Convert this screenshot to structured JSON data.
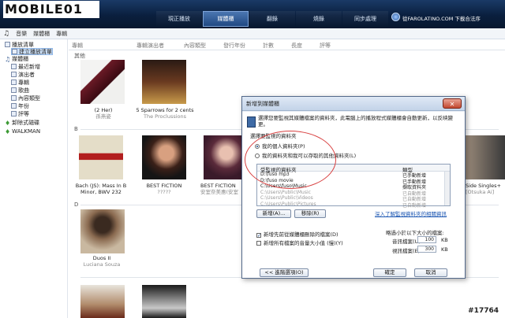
{
  "brand": {
    "logo_text": "MOBILE01"
  },
  "topnav": {
    "tabs": [
      "現正播放",
      "媒體櫃",
      "翻錄",
      "燒錄",
      "同步處理"
    ],
    "active_index": 1,
    "right_text": "從FAROLATINO.COM 下載合法序"
  },
  "address": {
    "crumbs": [
      "音樂",
      "媒體櫃",
      "專輯"
    ]
  },
  "sidebar": {
    "items": [
      {
        "label": "播放清單",
        "icon": "playlist-icon"
      },
      {
        "label": "建立播放清單",
        "icon": "playlist-add-icon"
      },
      {
        "label": "媒體櫃",
        "icon": "music-note-icon"
      },
      {
        "label": "最近新增",
        "icon": "clock-icon"
      },
      {
        "label": "演出者",
        "icon": "artist-icon"
      },
      {
        "label": "專輯",
        "icon": "album-icon"
      },
      {
        "label": "歌曲",
        "icon": "song-icon"
      },
      {
        "label": "內容類型",
        "icon": "genre-icon"
      },
      {
        "label": "年份",
        "icon": "calendar-icon"
      },
      {
        "label": "評等",
        "icon": "star-icon"
      },
      {
        "label": "卸除式磁碟",
        "icon": "drive-icon"
      },
      {
        "label": "WALKMAN",
        "icon": "walkman-icon"
      }
    ]
  },
  "columns": [
    "專輯",
    "專輯演出者",
    "內容類型",
    "發行年份",
    "計數",
    "長度",
    "評等"
  ],
  "groups": [
    {
      "label": "其他"
    },
    {
      "label": "B"
    },
    {
      "label": "D"
    },
    {
      "label": ""
    }
  ],
  "albums": [
    {
      "title": "(2 Her)",
      "artist": "孫燕姿",
      "colors": [
        "#f1f1f0",
        "#5b1220"
      ]
    },
    {
      "title": "5 Sparrows for 2 cents",
      "artist": "The Proclussions",
      "colors": [
        "#2a1a14",
        "#c89a4a"
      ]
    },
    {
      "title": "Bach (JS): Mass In B Minor, BWV 232",
      "artist": "",
      "colors": [
        "#e4ddc8",
        "#b21e1e"
      ]
    },
    {
      "title": "BEST FICTION",
      "artist": "?????",
      "colors": [
        "#151515",
        "#d8a080"
      ]
    },
    {
      "title": "BEST FICTION",
      "artist": "安室奈美惠(安室",
      "colors": [
        "#3a1a2a",
        "#e8c0b0"
      ]
    },
    {
      "title": "Side Singles+",
      "artist": "[Otsuka Ai]",
      "colors": [
        "#3a3a3a",
        "#9a8a7a"
      ]
    },
    {
      "title": "Duos II",
      "artist": "Luciana Souza",
      "colors": [
        "#c9b8a0",
        "#3a2a20"
      ]
    },
    {
      "title": "",
      "artist": "",
      "colors": [
        "#e8e4dc",
        "#6a2a1a"
      ]
    },
    {
      "title": "",
      "artist": "",
      "colors": [
        "#1a1a1a",
        "#c8c8c8"
      ]
    }
  ],
  "dialog": {
    "title": "新增到媒體櫃",
    "close": "✕",
    "description": "選擇您要監視其媒體檔案的資料夾，此電腦上的播放程式媒體櫃會自動更新，以反映變更。",
    "section_title": "選擇要監視的資料夾",
    "radio_options": [
      {
        "label": "我的個人資料夾(P)",
        "selected": true
      },
      {
        "label": "我的資料夾和我可以存取的其他資料夾(L)",
        "selected": false
      }
    ],
    "list": {
      "headers": [
        "受監視的資料夾",
        "類型"
      ],
      "rows": [
        {
          "folder": "D:\\fuso mp3",
          "type": "已手動新增",
          "dim": false
        },
        {
          "folder": "D:\\fuso movie",
          "type": "已手動新增",
          "dim": false
        },
        {
          "folder": "C:\\Users\\fuso\\Music",
          "type": "擷取資料夾",
          "dim": false
        },
        {
          "folder": "C:\\Users\\Public\\Music",
          "type": "已自動新增",
          "dim": true
        },
        {
          "folder": "C:\\Users\\Public\\Videos",
          "type": "已自動新增",
          "dim": true
        },
        {
          "folder": "C:\\Users\\Public\\Pictures",
          "type": "已自動新增",
          "dim": true
        }
      ]
    },
    "buttons": {
      "add": "新增(A)...",
      "remove": "移除(R)",
      "advanced": "<< 進階選項(O)",
      "ok": "確定",
      "cancel": "取消"
    },
    "link": "深入了解監視資料夾的相關資訊",
    "checkboxes": [
      {
        "label": "新增先前從媒體櫃刪除的檔案(D)",
        "checked": true
      },
      {
        "label": "新增所有檔案的音量大小值 (慢)(Y)",
        "checked": false
      }
    ],
    "skip": {
      "title": "略過小於以下大小的檔案:",
      "audio_label": "音訊檔案(U):",
      "audio_value": "100",
      "video_label": "視訊檔案(E):",
      "video_value": "300",
      "unit": "KB"
    }
  },
  "watermark": "#17764"
}
